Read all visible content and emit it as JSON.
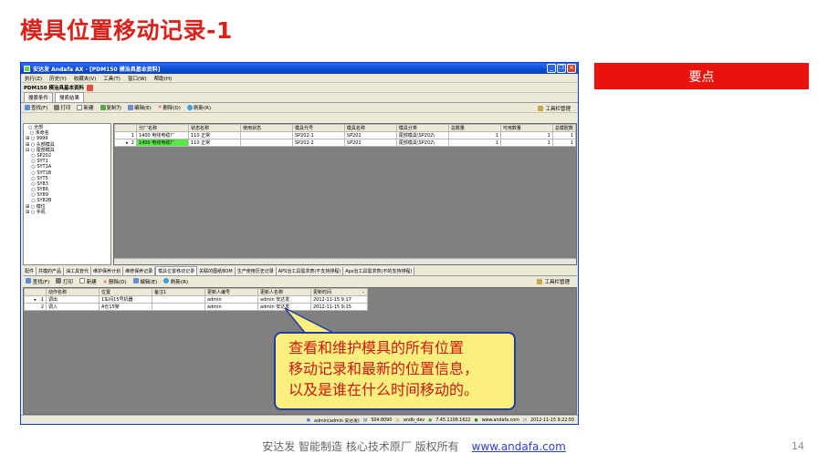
{
  "slide": {
    "title": "模具位置移动记录-1",
    "keypoint": "要点",
    "footer_text": "安达发   智能制造 核心技术原厂   版权所有",
    "footer_link": "www.andafa.com",
    "page_number": "14",
    "callout": [
      "查看和维护模具的所有位置",
      "移动记录和最新的位置信息，",
      "以及是谁在什么时间移动的。"
    ]
  },
  "window": {
    "title": "安达发 Andafa AX - [PDM150 模治具基本资料]",
    "menu": [
      "执行(Z)",
      "历史(Y)",
      "收藏夹(V)",
      "工具(T)",
      "窗口(W)",
      "帮助(H)"
    ],
    "doc_tab": "PDM150 模治具基本资料",
    "subtabs": [
      "搜索条件",
      "搜索结果"
    ],
    "toolbar": [
      "查找(F)",
      "打印",
      "新建",
      "复制为",
      "编辑(E)",
      "删除(D)",
      "刷新(R)"
    ],
    "toolbar_right": "工具栏管理",
    "tree": [
      "全部",
      "未命名",
      "9999",
      "头部模具",
      "尾部模具",
      "SP202",
      "SYT1",
      "SYT1A",
      "SYT1B",
      "SYT5",
      "SY83",
      "SY86",
      "SY89",
      "SY82B",
      "模位",
      "手机"
    ],
    "grid": {
      "columns": [
        "",
        "分厂名称",
        "状态名称",
        "使用状态",
        "模具代号",
        "模具名称",
        "模具分类",
        "总数量",
        "可用数量",
        "总模腔数"
      ],
      "rows": [
        [
          "1",
          "1400 电线电缆厂",
          "110 正常",
          "",
          "SP202-1",
          "SP202",
          "尾部模具\\SP202\\",
          "1",
          "1",
          "1"
        ],
        [
          "2",
          "1400 电线电缆厂",
          "110 正常",
          "",
          "SP202-2",
          "SP202",
          "尾部模具\\SP202\\",
          "1",
          "1",
          "1"
        ]
      ]
    },
    "bottom_tabs": [
      "配件",
      "共模的产品",
      "油工具管代",
      "维护保养计划",
      "维修保养记录",
      "模具位置移动记录",
      "关联的图纸BOM",
      "生产使用历史记录",
      "APS治工具需求表(不支持排程)",
      "Aps治工具需求表(不的支持排程)"
    ],
    "bottom_toolbar": [
      "查找(F)",
      "打印",
      "新建",
      "删除(D)",
      "编辑(E)",
      "刷新(R)"
    ],
    "bottom_toolbar_right": "工具栏管理",
    "bgrid": {
      "columns": [
        "",
        "动作名称",
        "位置",
        "备注1",
        "更新人编号",
        "更新人名称",
        "更新时间"
      ],
      "rows": [
        [
          "1",
          "调出",
          "1车间15号机器",
          "",
          "admin",
          "admin 安达发",
          "2012-11-15 9:17"
        ],
        [
          "2",
          "调入",
          "A仓15架",
          "",
          "admin",
          "admin 安达发",
          "2012-11-15 9:15"
        ]
      ]
    },
    "status": [
      "admin(admin 安达发)",
      "S04:8090",
      "andb_dev",
      "7.45.1106.1622",
      "www.andafa.com",
      "2012-11-15 9:22:50"
    ]
  }
}
